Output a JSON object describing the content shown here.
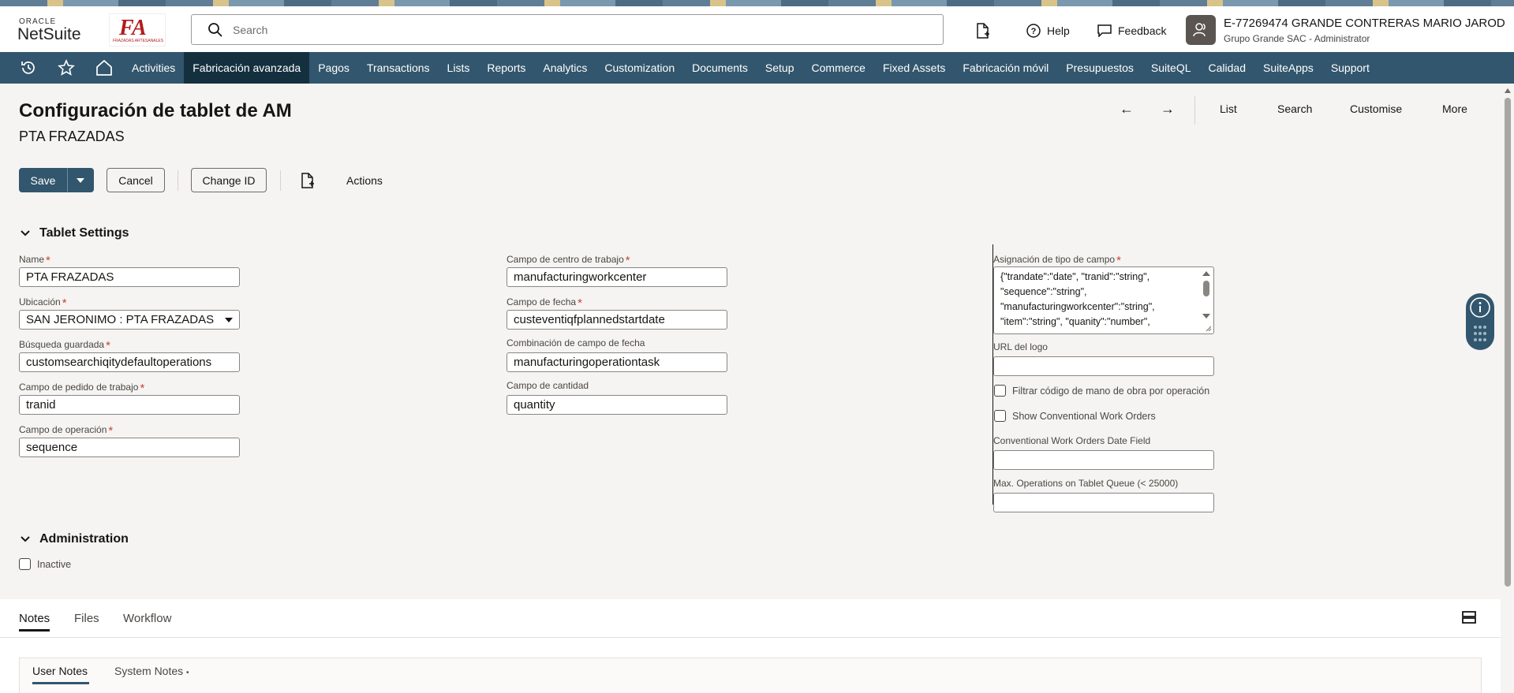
{
  "header": {
    "oracle_logo": "ORACLE",
    "netsuite_logo": "NetSuite",
    "company_logo_text": "FA",
    "company_logo_sub": "FRAZADAS ARTESANALES",
    "search_placeholder": "Search",
    "help_label": "Help",
    "feedback_label": "Feedback",
    "user_name": "E-77269474 GRANDE CONTRERAS MARIO JAROD",
    "user_role": "Grupo Grande SAC - Administrator"
  },
  "nav": {
    "items": [
      "Activities",
      "Fabricación avanzada",
      "Pagos",
      "Transactions",
      "Lists",
      "Reports",
      "Analytics",
      "Customization",
      "Documents",
      "Setup",
      "Commerce",
      "Fixed Assets",
      "Fabricación móvil",
      "Presupuestos",
      "SuiteQL",
      "Calidad",
      "SuiteApps",
      "Support"
    ],
    "active": "Fabricación avanzada"
  },
  "page": {
    "title": "Configuración de tablet de AM",
    "subtitle": "PTA FRAZADAS",
    "prev_arrow": "←",
    "next_arrow": "→",
    "actions": [
      "List",
      "Search",
      "Customise",
      "More"
    ]
  },
  "toolbar": {
    "save": "Save",
    "cancel": "Cancel",
    "change_id": "Change ID",
    "actions": "Actions"
  },
  "tablet_settings": {
    "title": "Tablet Settings",
    "name_label": "Name",
    "name_value": "PTA FRAZADAS",
    "ubicacion_label": "Ubicación",
    "ubicacion_value": "SAN JERONIMO : PTA FRAZADAS",
    "busqueda_label": "Búsqueda guardada",
    "busqueda_value": "customsearchiqitydefaultoperations",
    "pedido_label": "Campo de pedido de trabajo",
    "pedido_value": "tranid",
    "operacion_label": "Campo de operación",
    "operacion_value": "sequence",
    "centro_label": "Campo de centro de trabajo",
    "centro_value": "manufacturingworkcenter",
    "fecha_label": "Campo de fecha",
    "fecha_value": "custeventiqfplannedstartdate",
    "combinacion_label": "Combinación de campo de fecha",
    "combinacion_value": "manufacturingoperationtask",
    "cantidad_label": "Campo de cantidad",
    "cantidad_value": "quantity",
    "asignacion_label": "Asignación de tipo de campo",
    "asignacion_lines": [
      "{\"trandate\":\"date\", \"tranid\":\"string\",",
      "\"sequence\":\"string\",",
      "\"manufacturingworkcenter\":\"string\",",
      "\"item\":\"string\", \"quanity\":\"number\","
    ],
    "logo_label": "URL del logo",
    "filtrar_label": "Filtrar código de mano de obra por operación",
    "show_conv_label": "Show Conventional Work Orders",
    "conv_date_label": "Conventional Work Orders Date Field",
    "max_ops_label": "Max. Operations on Tablet Queue (< 25000)"
  },
  "administration": {
    "title": "Administration",
    "inactive_label": "Inactive"
  },
  "tabs": {
    "items": [
      "Notes",
      "Files",
      "Workflow"
    ],
    "active": "Notes",
    "subtabs": [
      "User Notes",
      "System Notes"
    ],
    "system_notes_dot": "•"
  }
}
